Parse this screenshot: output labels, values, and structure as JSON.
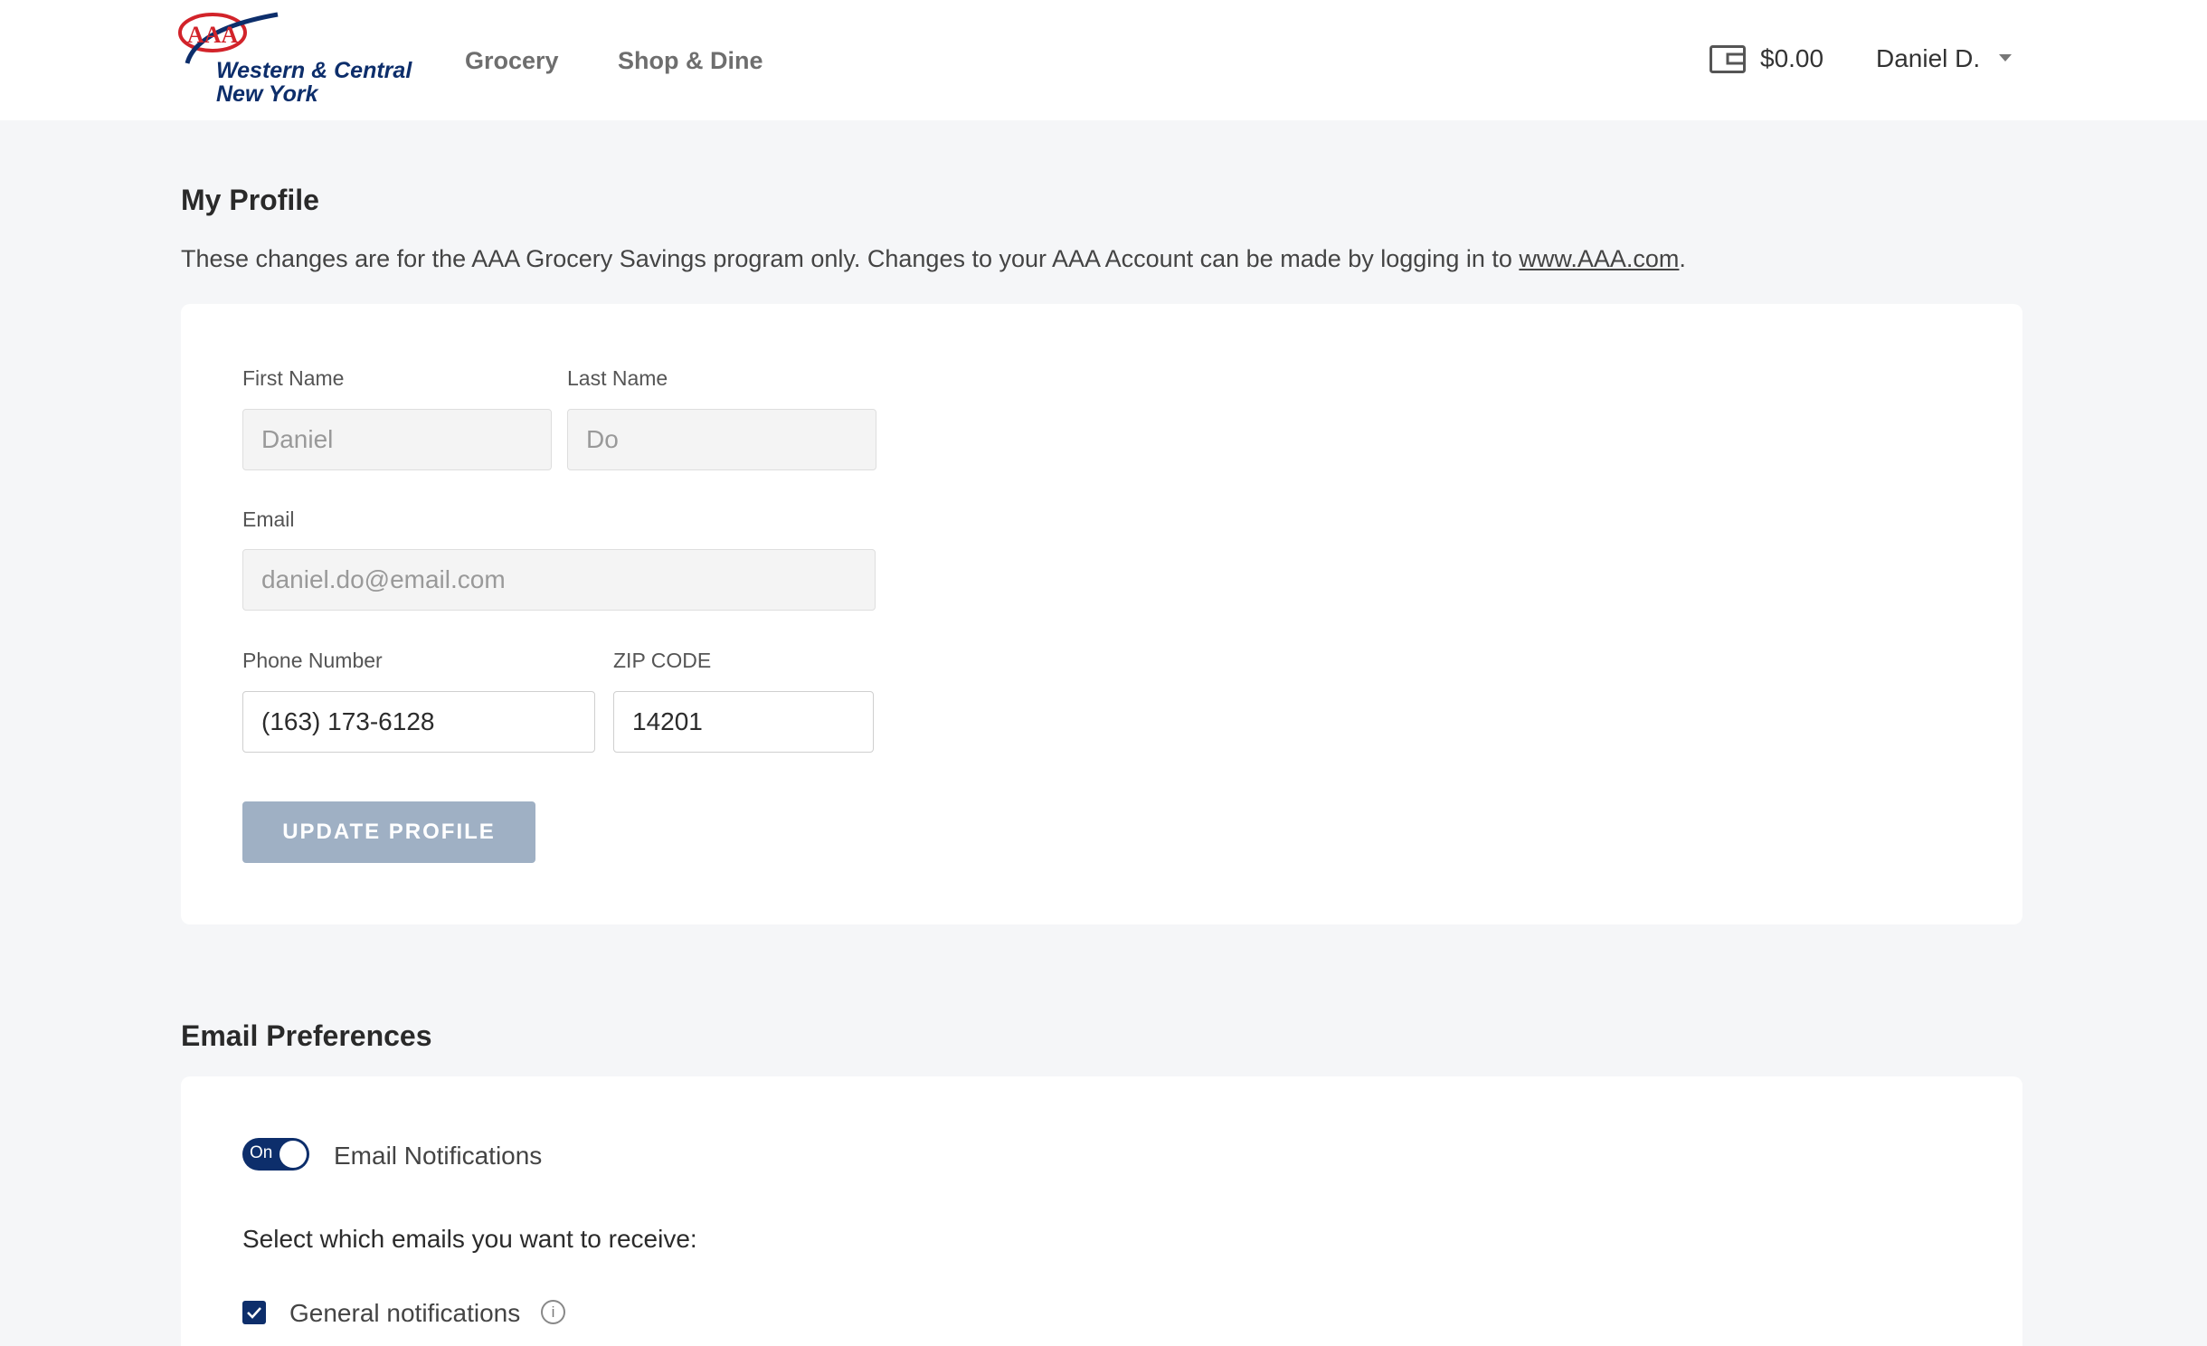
{
  "header": {
    "logo": {
      "brand": "AAA",
      "line1": "Western & Central",
      "line2": "New York"
    },
    "nav": {
      "grocery": "Grocery",
      "shop_dine": "Shop & Dine"
    },
    "wallet_icon": "wallet-icon",
    "balance": "$0.00",
    "user_name": "Daniel D."
  },
  "profile": {
    "title": "My Profile",
    "intro_text": "These changes are for the AAA Grocery Savings program only. Changes to your AAA Account can be made by logging in to ",
    "intro_link": "www.AAA.com",
    "intro_end": ".",
    "first_name": {
      "label": "First Name",
      "value": "Daniel"
    },
    "last_name": {
      "label": "Last Name",
      "value": "Do"
    },
    "email": {
      "label": "Email",
      "value": "daniel.do@email.com"
    },
    "phone": {
      "label": "Phone Number",
      "value": "(163) 173-6128"
    },
    "zip": {
      "label": "ZIP CODE",
      "value": "14201"
    },
    "update_button": "UPDATE PROFILE"
  },
  "email_prefs": {
    "title": "Email Preferences",
    "toggle_state": "On",
    "toggle_label": "Email Notifications",
    "select_prompt": "Select which emails you want to receive:",
    "options": [
      {
        "label": "General notifications",
        "checked": true
      }
    ]
  },
  "colors": {
    "brand_navy": "#0d2e6b",
    "aaa_red": "#d2232a",
    "button_disabled": "#9fb0c4"
  }
}
